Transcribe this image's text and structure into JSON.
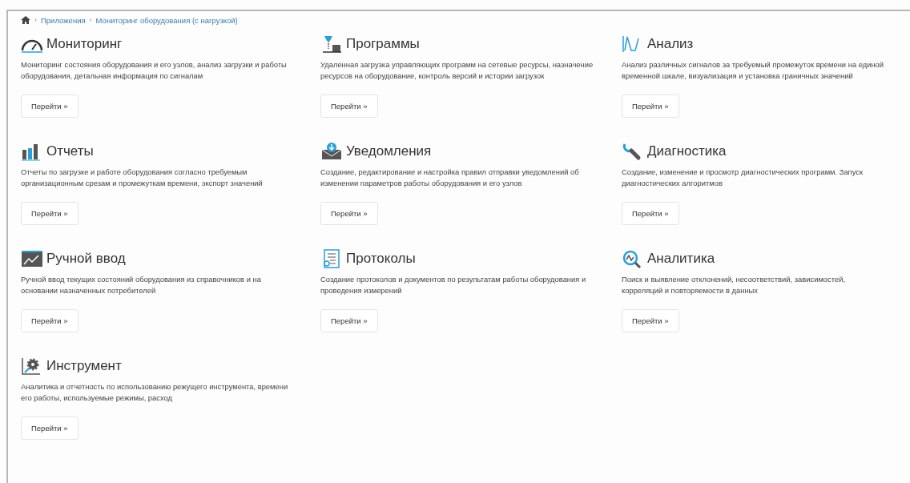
{
  "breadcrumb": {
    "items": [
      "Приложения",
      "Мониторинг оборудования (с нагрузкой)"
    ],
    "separator": "›"
  },
  "modules": [
    {
      "title": "Мониторинг",
      "description": "Мониторинг состояния оборудования и его узлов, анализ загрузки и работы оборудования, детальная информация по сигналам",
      "button": "Перейти »"
    },
    {
      "title": "Программы",
      "description": "Удаленная загрузка управляющих программ на сетевые ресурсы, назначение ресурсов на оборудование, контроль версий и истории загрузок",
      "button": "Перейти »"
    },
    {
      "title": "Анализ",
      "description": "Анализ различных сигналов за требуемый промежуток времени на единой временной шкале, визуализация и установка граничных значений",
      "button": "Перейти »"
    },
    {
      "title": "Отчеты",
      "description": "Отчеты по загрузке и работе оборудования согласно требуемым организационным срезам и промежуткам времени, экспорт значений",
      "button": "Перейти »"
    },
    {
      "title": "Уведомления",
      "description": "Создание, редактирование и настройка правил отправки уведомлений об изменении параметров работы оборудования и его узлов",
      "button": "Перейти »"
    },
    {
      "title": "Диагностика",
      "description": "Создание, изменение и просмотр диагностических программ. Запуск диагностических алгоритмов",
      "button": "Перейти »"
    },
    {
      "title": "Ручной ввод",
      "description": "Ручной ввод текущих состояний оборудования из справочников и на основании назначенных потребителей",
      "button": "Перейти »"
    },
    {
      "title": "Протоколы",
      "description": "Создание протоколов и документов по результатам работы оборудования и проведения измерений",
      "button": "Перейти »"
    },
    {
      "title": "Аналитика",
      "description": "Поиск и выявление отклонений, несоответствий, зависимостей, корреляций и повторяемости в данных",
      "button": "Перейти »"
    },
    {
      "title": "Инструмент",
      "description": "Аналитика и отчетность по использованию режущего инструмента, времени его работы, используемые режимы, расход",
      "button": "Перейти »"
    }
  ]
}
